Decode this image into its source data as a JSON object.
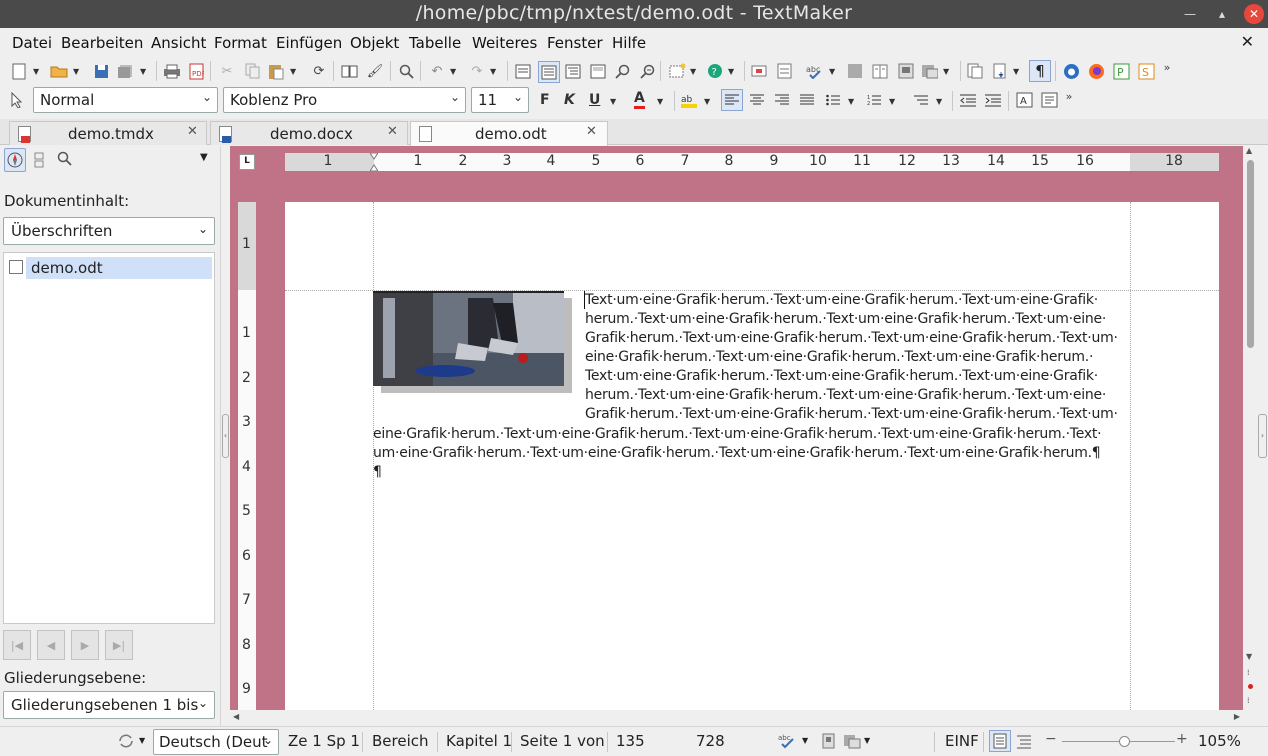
{
  "window": {
    "title": "/home/pbc/tmp/nxtest/demo.odt - TextMaker"
  },
  "menu": [
    "Datei",
    "Bearbeiten",
    "Ansicht",
    "Format",
    "Einfügen",
    "Objekt",
    "Tabelle",
    "Weiteres",
    "Fenster",
    "Hilfe"
  ],
  "format_bar": {
    "style": "Normal",
    "font": "Koblenz Pro",
    "size": "11",
    "bold": "F",
    "italic": "K",
    "underline": "U",
    "font_color": "A"
  },
  "tabs": [
    {
      "label": "demo.tmdx",
      "active": false
    },
    {
      "label": "demo.docx",
      "active": false
    },
    {
      "label": "demo.odt",
      "active": true
    }
  ],
  "sidebar": {
    "content_label": "Dokumentinhalt:",
    "content_select": "Überschriften",
    "tree_item": "demo.odt",
    "outline_label": "Gliederungsebene:",
    "outline_select": "Gliederungsebenen 1 bis"
  },
  "ruler": {
    "h": [
      "1",
      "1",
      "2",
      "3",
      "4",
      "5",
      "6",
      "7",
      "8",
      "9",
      "10",
      "11",
      "12",
      "13",
      "14",
      "15",
      "16",
      "18"
    ],
    "v_top": "1",
    "v": [
      "1",
      "2",
      "3",
      "4",
      "5",
      "6",
      "7",
      "8",
      "9"
    ]
  },
  "document": {
    "lines": [
      "Text·um·eine·Grafik·herum.·Text·um·eine·Grafik·herum.·Text·um·eine·Grafik·",
      "herum.·Text·um·eine·Grafik·herum.·Text·um·eine·Grafik·herum.·Text·um·eine·",
      "Grafik·herum.·Text·um·eine·Grafik·herum.·Text·um·eine·Grafik·herum.·Text·um·",
      "eine·Grafik·herum.·Text·um·eine·Grafik·herum.·Text·um·eine·Grafik·herum.·",
      "Text·um·eine·Grafik·herum.·Text·um·eine·Grafik·herum.·Text·um·eine·Grafik·",
      "herum.·Text·um·eine·Grafik·herum.·Text·um·eine·Grafik·herum.·Text·um·eine·",
      "Grafik·herum.·Text·um·eine·Grafik·herum.·Text·um·eine·Grafik·herum.·Text·um·",
      "eine·Grafik·herum.·Text·um·eine·Grafik·herum.·Text·um·eine·Grafik·herum.·Text·um·eine·Grafik·herum.·Text·",
      "um·eine·Grafik·herum.·Text·um·eine·Grafik·herum.·Text·um·eine·Grafik·herum.·Text·um·eine·Grafik·herum.¶",
      "¶"
    ]
  },
  "status": {
    "language": "Deutsch (Deut",
    "position": "Ze 1 Sp 1",
    "section": "Bereich",
    "chapter": "Kapitel 1",
    "page": "Seite 1 von",
    "v1": "135",
    "v2": "728",
    "mode": "EINF",
    "zoom": "105%",
    "zoom_level": 0.55
  }
}
